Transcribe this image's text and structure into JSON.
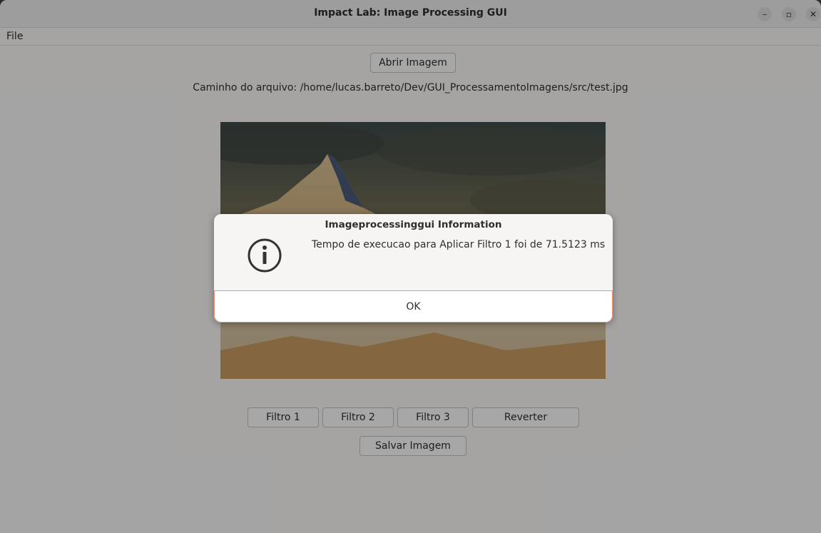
{
  "window": {
    "title": "Impact Lab: Image Processing GUI",
    "controls": {
      "minimize": "–",
      "maximize": "▫",
      "close": "✕"
    }
  },
  "menubar": {
    "file": "File"
  },
  "main": {
    "open_button": "Abrir Imagem",
    "file_path": "Caminho do arquivo: /home/lucas.barreto/Dev/GUI_ProcessamentoImagens/src/test.jpg",
    "buttons": {
      "filter1": "Filtro 1",
      "filter2": "Filtro 2",
      "filter3": "Filtro 3",
      "revert": "Reverter",
      "save": "Salvar Imagem"
    }
  },
  "dialog": {
    "title": "Imageprocessinggui Information",
    "icon": "info-icon",
    "message": "Tempo de execucao para Aplicar Filtro 1 foi de 71.5123 ms",
    "ok": "OK"
  },
  "colors": {
    "dialog_ok_border": "#e9967a",
    "dim_overlay": "rgba(0,0,0,0.33)"
  }
}
